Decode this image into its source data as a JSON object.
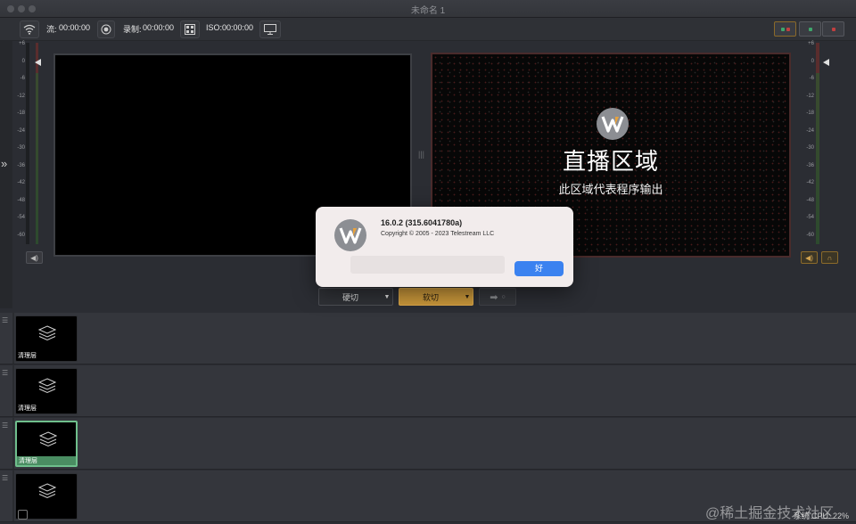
{
  "window": {
    "title": "未命名 1"
  },
  "toolbar": {
    "stream_label": "流:",
    "stream_time": "00:00:00",
    "record_label": "录制:",
    "record_time": "00:00:00",
    "iso_label": "ISO:",
    "iso_time": "00:00:00"
  },
  "meters": {
    "ticks": [
      "+6",
      "0",
      "-6",
      "-12",
      "-18",
      "-24",
      "-30",
      "-36",
      "-42",
      "-48",
      "-54",
      "-60"
    ]
  },
  "live": {
    "title": "直播区域",
    "subtitle": "此区域代表程序输出"
  },
  "transitions": {
    "cut_label": "硬切",
    "fade_label": "软切"
  },
  "layers": [
    {
      "label": "清理层",
      "selected": false
    },
    {
      "label": "清理层",
      "selected": false
    },
    {
      "label": "清理层",
      "selected": true
    },
    {
      "label": "",
      "selected": false
    }
  ],
  "dialog": {
    "version": "16.0.2 (315.6041780a)",
    "copyright": "Copyright © 2005 - 2023 Telestream LLC",
    "ok_label": "好"
  },
  "status": {
    "cpu_label": "系统 CPU:",
    "cpu_value": "22%"
  },
  "watermark": "@稀土掘金技术社区",
  "colors": {
    "accent_gold": "#c8963a",
    "ok_blue": "#3b82f0",
    "select_green": "#6fbf8c"
  }
}
